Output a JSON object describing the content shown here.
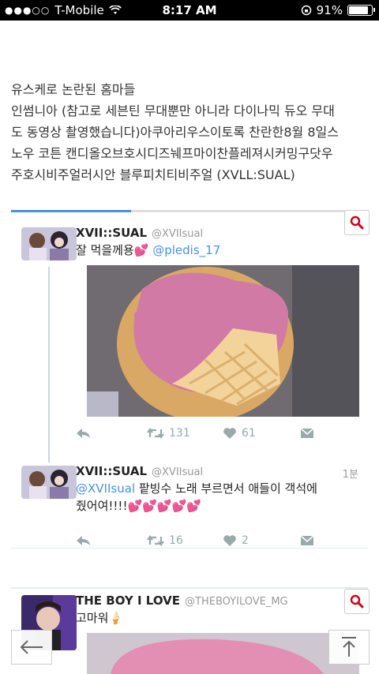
{
  "status_bar": {
    "carrier": "T-Mobile",
    "time": "8:17 AM",
    "battery": "91%"
  },
  "article": {
    "lines": [
      "유스케로 논란된 홈마들",
      "인썸니아 (참고로 세븐틴 무대뿐만 아니라 다이나믹 듀오 무대",
      "도 동영상 촬영했습니다)아쿠아리우스이토록 찬란한8월 8일스",
      "노우 코튼 캔디올오브호시디즈눼프마이찬플레져시커밍구닷우",
      "주호시비주얼러시안 블루피치티비주얼 (XVLL:SUAL)"
    ]
  },
  "tweets": [
    {
      "name": "XVII::SUAL",
      "handle": "@XVIIsual",
      "text": "잘 먹을께용💕",
      "mention": "@pledis_17",
      "retweets": "131",
      "likes": "61"
    },
    {
      "name": "XVII::SUAL",
      "handle": "@XVIIsual",
      "time": "1분",
      "mention": "@XVIIsual",
      "text1": " 팥빙수 노래 부르면서 애들이 객석에",
      "text2": "줬어여!!!!💕💕💕💕💕",
      "retweets": "16",
      "likes": "2"
    },
    {
      "name": "THE BOY I LOVE",
      "handle": "@THEBOYILOVE_MG",
      "text": "고마워🍦"
    }
  ],
  "icons": {
    "search": "search-icon",
    "reply": "reply-icon",
    "retweet": "retweet-icon",
    "like": "heart-icon",
    "dm": "message-icon",
    "back": "arrow-left-icon",
    "top": "arrow-up-icon"
  },
  "colors": {
    "accent": "#4a90e2",
    "search_red": "#d0021b"
  }
}
